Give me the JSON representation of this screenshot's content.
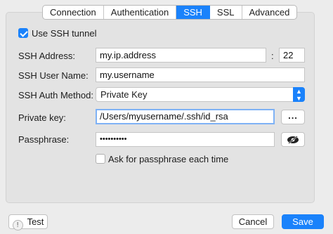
{
  "tabs": [
    {
      "label": "Connection"
    },
    {
      "label": "Authentication"
    },
    {
      "label": "SSH"
    },
    {
      "label": "SSL"
    },
    {
      "label": "Advanced"
    }
  ],
  "active_tab": "SSH",
  "ssh": {
    "use_tunnel_label": "Use SSH tunnel",
    "use_tunnel_checked": true,
    "address_label": "SSH Address:",
    "address_value": "my.ip.address",
    "port_separator": ":",
    "port_value": "22",
    "user_label": "SSH User Name:",
    "user_value": "my.username",
    "auth_label": "SSH Auth Method:",
    "auth_value": "Private Key",
    "key_label": "Private key:",
    "key_value": "/Users/myusername/.ssh/id_rsa",
    "browse_label": "...",
    "passphrase_label": "Passphrase:",
    "passphrase_masked": "••••••••••",
    "ask_label": "Ask for passphrase each time",
    "ask_checked": false
  },
  "footer": {
    "test_label": "Test",
    "cancel_label": "Cancel",
    "save_label": "Save"
  },
  "colors": {
    "accent": "#1a82fb",
    "background": "#ececec",
    "panel": "#e3e3e3"
  },
  "icons": {
    "test": "exclamation-icon",
    "reveal": "eye-slash-icon",
    "select_arrows": "updown-chevron-icon"
  }
}
